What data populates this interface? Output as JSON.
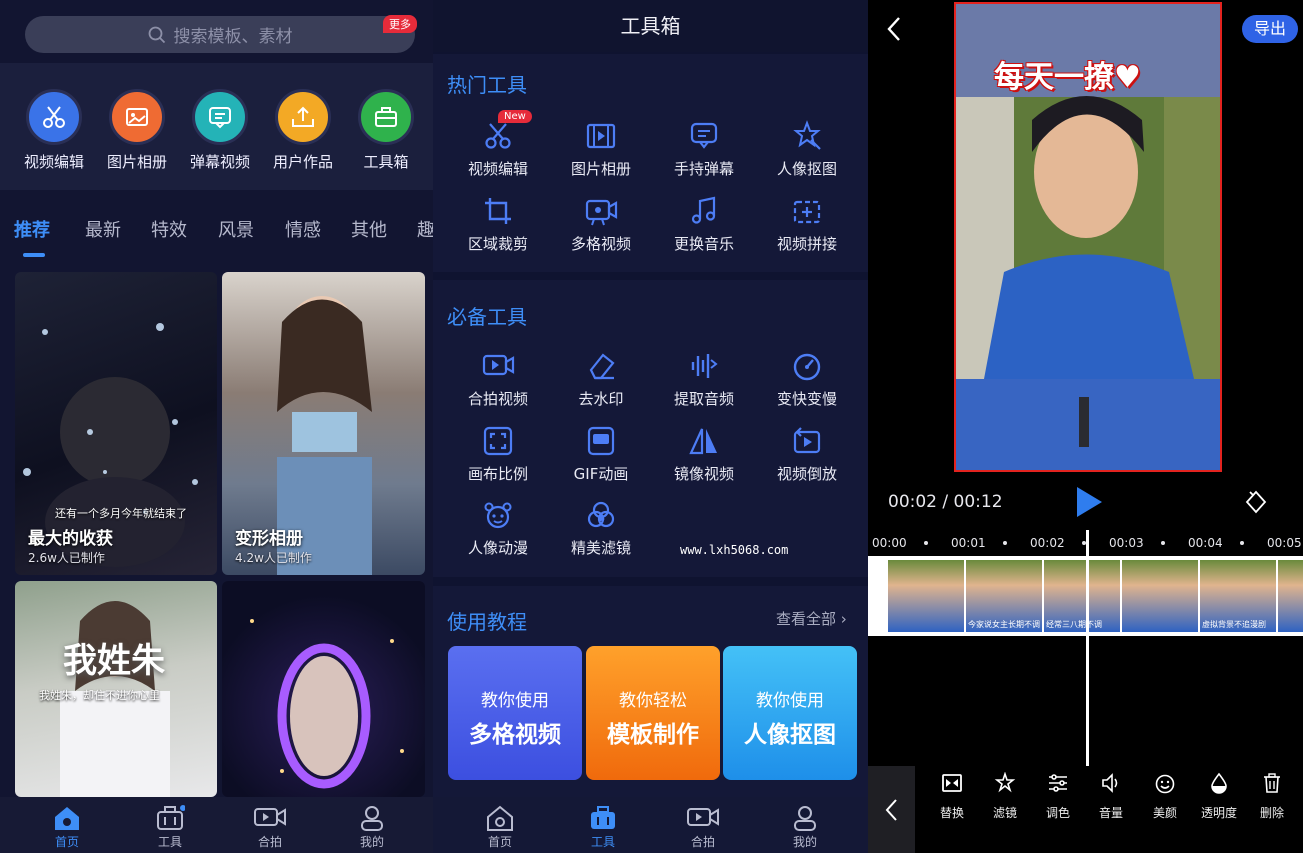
{
  "home": {
    "search_placeholder": "搜索模板、素材",
    "more_badge": "更多",
    "tools": [
      {
        "label": "视频编辑",
        "color": "#3a73e8",
        "icon": "scissors-icon"
      },
      {
        "label": "图片相册",
        "color": "#ef6b33",
        "icon": "photo-icon"
      },
      {
        "label": "弹幕视频",
        "color": "#24b3b7",
        "icon": "comment-icon"
      },
      {
        "label": "用户作品",
        "color": "#f3a925",
        "icon": "upload-icon"
      },
      {
        "label": "工具箱",
        "color": "#2fb24c",
        "icon": "toolbox-icon"
      }
    ],
    "categories": [
      "推荐",
      "最新",
      "特效",
      "风景",
      "情感",
      "其他",
      "趣"
    ],
    "cards": [
      {
        "title": "最大的收获",
        "sub": "2.6w人已制作",
        "overlay": "还有一个多月今年就结束了"
      },
      {
        "title": "变形相册",
        "sub": "4.2w人已制作"
      },
      {
        "big": "我姓朱",
        "overlay": "我姓朱，却住不进你心里"
      },
      {}
    ],
    "nav": [
      "首页",
      "工具",
      "合拍",
      "我的"
    ]
  },
  "toolbox": {
    "title": "工具箱",
    "hot_title": "热门工具",
    "new_badge": "New",
    "hot": [
      "视频编辑",
      "图片相册",
      "手持弹幕",
      "人像抠图",
      "区域裁剪",
      "多格视频",
      "更换音乐",
      "视频拼接"
    ],
    "must_title": "必备工具",
    "must": [
      "合拍视频",
      "去水印",
      "提取音频",
      "变快变慢",
      "画布比例",
      "GIF动画",
      "镜像视频",
      "视频倒放",
      "人像动漫",
      "精美滤镜"
    ],
    "tut_title": "使用教程",
    "see_all": "查看全部",
    "tutorials": [
      {
        "l1": "教你使用",
        "l2": "多格视频",
        "color": "#4562ea"
      },
      {
        "l1": "教你轻松",
        "l2": "模板制作",
        "color": "#f5820f"
      },
      {
        "l1": "教你使用",
        "l2": "人像抠图",
        "color": "#2ea6f2"
      }
    ],
    "nav": [
      "首页",
      "工具",
      "合拍",
      "我的"
    ],
    "watermark": "www.lxh5068.com"
  },
  "editor": {
    "export": "导出",
    "video_title": "每天一撩♥",
    "timecode": "00:02 / 00:12",
    "ruler": [
      "00:00",
      "00:01",
      "00:02",
      "00:03",
      "00:04",
      "00:05"
    ],
    "thumb_captions": [
      "",
      "今家说女主长期不调",
      "经常三八期不调",
      "",
      "虚拟背景不追漫剧",
      ""
    ],
    "tools": [
      "替换",
      "滤镜",
      "调色",
      "音量",
      "美颜",
      "透明度",
      "删除"
    ],
    "colors": {
      "accent": "#2f63e6",
      "frame": "#e3231f"
    }
  }
}
